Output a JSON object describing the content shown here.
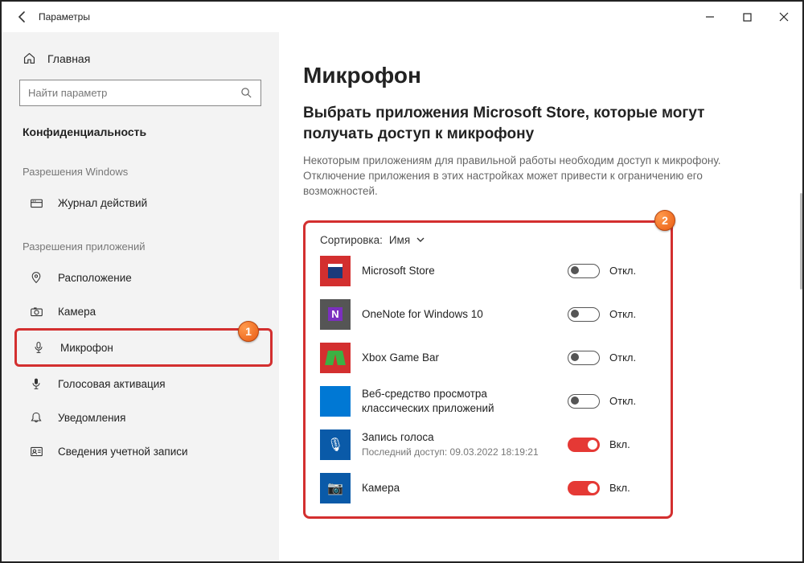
{
  "titlebar": {
    "title": "Параметры"
  },
  "sidebar": {
    "home": "Главная",
    "search_placeholder": "Найти параметр",
    "category": "Конфиденциальность",
    "group_windows": "Разрешения Windows",
    "item_activity": "Журнал действий",
    "group_apps": "Разрешения приложений",
    "item_location": "Расположение",
    "item_camera": "Камера",
    "item_microphone": "Микрофон",
    "item_voice": "Голосовая активация",
    "item_notifications": "Уведомления",
    "item_account": "Сведения учетной записи"
  },
  "main": {
    "heading": "Микрофон",
    "subheading": "Выбрать приложения Microsoft Store, которые могут получать доступ к микрофону",
    "description": "Некоторым приложениям для правильной работы необходим доступ к микрофону. Отключение приложения в этих настройках может привести к ограничению его возможностей.",
    "sort_label": "Сортировка:",
    "sort_value": "Имя",
    "status_off": "Откл.",
    "status_on": "Вкл.",
    "apps": [
      {
        "name": "Microsoft Store",
        "on": false
      },
      {
        "name": "OneNote for Windows 10",
        "on": false
      },
      {
        "name": "Xbox Game Bar",
        "on": false
      },
      {
        "name": "Веб-средство просмотра классических приложений",
        "on": false
      },
      {
        "name": "Запись голоса",
        "sub": "Последний доступ: 09.03.2022 18:19:21",
        "on": true
      },
      {
        "name": "Камера",
        "on": true
      }
    ]
  },
  "annotations": {
    "badge1": "1",
    "badge2": "2"
  }
}
